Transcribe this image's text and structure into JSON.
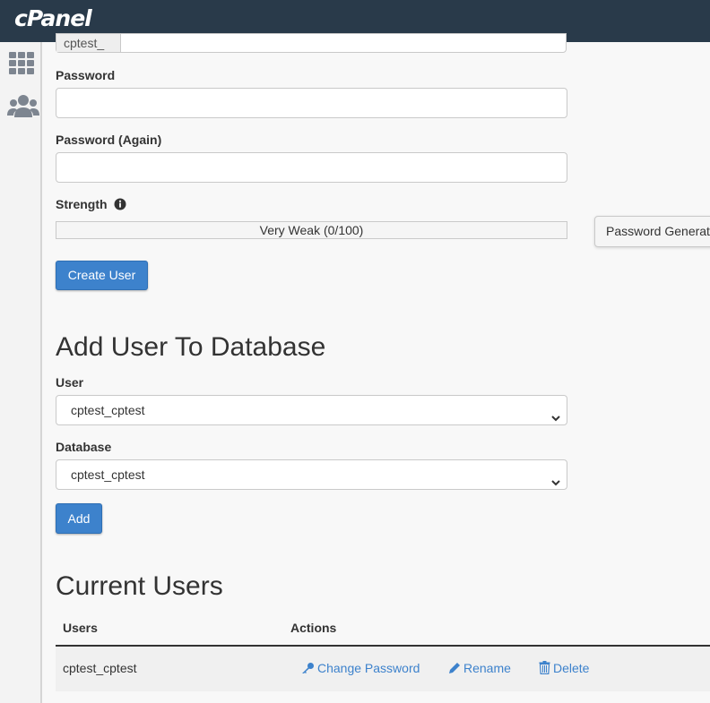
{
  "header": {
    "logo_text": "cPanel"
  },
  "sidebar": {
    "items": [
      {
        "icon": "grid-icon",
        "label": "Tools"
      },
      {
        "icon": "users-icon",
        "label": "Users"
      }
    ]
  },
  "create_user": {
    "username_prefix": "cptest_",
    "password_label": "Password",
    "password_again_label": "Password (Again)",
    "strength_label": "Strength",
    "strength_value": "Very Weak (0/100)",
    "strength_percent": 0,
    "generator_label": "Password Generat",
    "create_button": "Create User"
  },
  "add_user_to_db": {
    "title": "Add User To Database",
    "user_label": "User",
    "user_value": "cptest_cptest",
    "database_label": "Database",
    "database_value": "cptest_cptest",
    "add_button": "Add"
  },
  "current_users": {
    "title": "Current Users",
    "columns": [
      "Users",
      "Actions"
    ],
    "rows": [
      {
        "user": "cptest_cptest",
        "actions": [
          "Change Password",
          "Rename",
          "Delete"
        ]
      }
    ]
  },
  "colors": {
    "topbar": "#293a4a",
    "primary": "#3d82cc",
    "link": "#3d82cc"
  }
}
